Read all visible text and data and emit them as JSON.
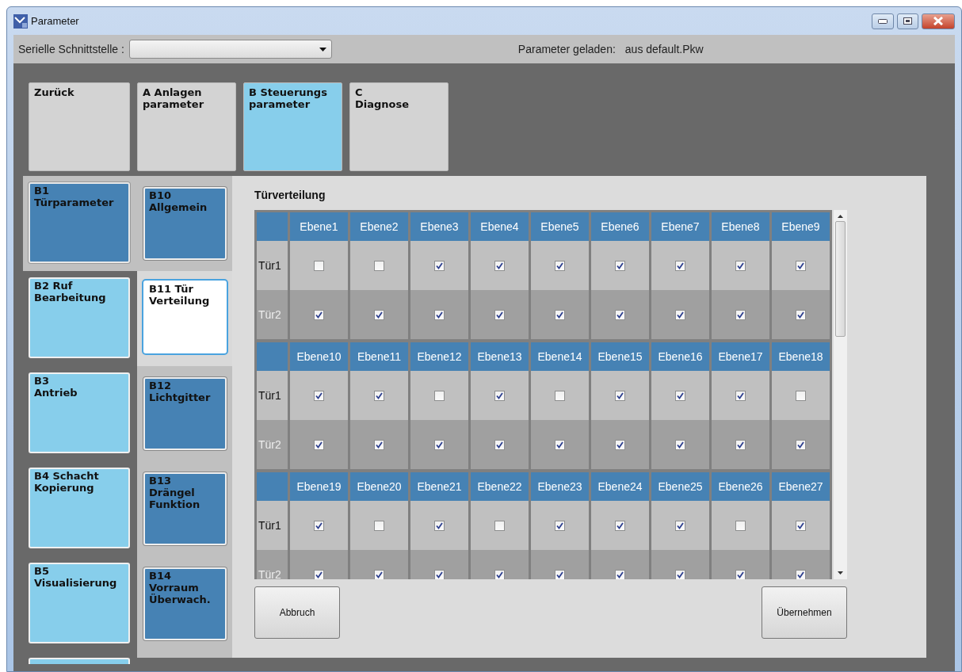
{
  "window": {
    "title": "Parameter"
  },
  "toolbar": {
    "port_label": "Serielle Schnittstelle :",
    "status_label": "Parameter geladen:",
    "status_value": "aus default.Pkw"
  },
  "main_tabs": [
    {
      "label": "Zurück",
      "selected": false
    },
    {
      "label": "A Anlagen\n parameter",
      "selected": false
    },
    {
      "label": "B Steuerungs\n parameter",
      "selected": true
    },
    {
      "label": "C\nDiagnose",
      "selected": false
    }
  ],
  "sections": [
    {
      "label": "B1\nTürparameter",
      "selected": true
    },
    {
      "label": "B2 Ruf\nBearbeitung",
      "selected": false
    },
    {
      "label": "B3\nAntrieb",
      "selected": false
    },
    {
      "label": "B4 Schacht\nKopierung",
      "selected": false
    },
    {
      "label": "B5\nVisualisierung",
      "selected": false
    }
  ],
  "subsections": [
    {
      "label": "B10\nAllgemein",
      "selected": false
    },
    {
      "label": "B11 Tür\nVerteilung",
      "selected": true
    },
    {
      "label": "B12\nLichtgitter",
      "selected": false
    },
    {
      "label": "B13\nDrängel\nFunktion",
      "selected": false
    },
    {
      "label": "B14\nVorraum\nÜberwach.",
      "selected": false
    }
  ],
  "panel": {
    "title": "Türverteilung",
    "blocks": [
      {
        "columns": [
          "Ebene1",
          "Ebene2",
          "Ebene3",
          "Ebene4",
          "Ebene5",
          "Ebene6",
          "Ebene7",
          "Ebene8",
          "Ebene9"
        ],
        "rows": [
          {
            "label": "Tür1",
            "checks": [
              false,
              false,
              true,
              true,
              true,
              true,
              true,
              true,
              true
            ]
          },
          {
            "label": "Tür2",
            "checks": [
              true,
              true,
              true,
              true,
              true,
              true,
              true,
              true,
              true
            ]
          }
        ]
      },
      {
        "columns": [
          "Ebene10",
          "Ebene11",
          "Ebene12",
          "Ebene13",
          "Ebene14",
          "Ebene15",
          "Ebene16",
          "Ebene17",
          "Ebene18"
        ],
        "rows": [
          {
            "label": "Tür1",
            "checks": [
              true,
              true,
              false,
              true,
              false,
              true,
              true,
              true,
              false
            ]
          },
          {
            "label": "Tür2",
            "checks": [
              true,
              true,
              true,
              true,
              true,
              true,
              true,
              true,
              true
            ]
          }
        ]
      },
      {
        "columns": [
          "Ebene19",
          "Ebene20",
          "Ebene21",
          "Ebene22",
          "Ebene23",
          "Ebene24",
          "Ebene25",
          "Ebene26",
          "Ebene27"
        ],
        "rows": [
          {
            "label": "Tür1",
            "checks": [
              true,
              false,
              true,
              false,
              true,
              true,
              true,
              false,
              true
            ]
          },
          {
            "label": "Tür2",
            "checks": [
              true,
              true,
              true,
              true,
              true,
              true,
              true,
              true,
              true
            ]
          }
        ]
      }
    ],
    "buttons": [
      "Abbruch",
      "Übernehmen"
    ]
  }
}
